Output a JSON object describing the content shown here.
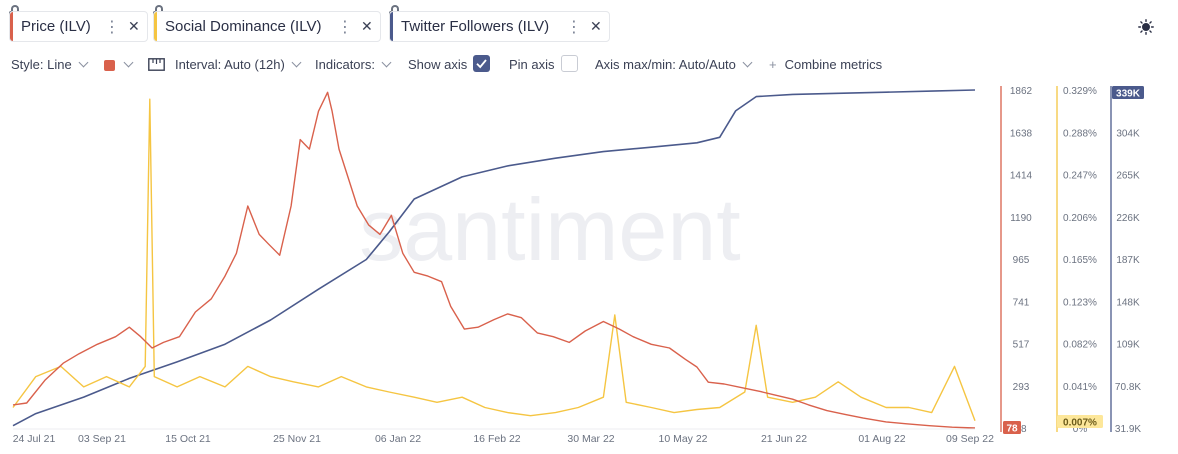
{
  "tabs": [
    {
      "label": "Price (ILV)",
      "color": "#d9614c"
    },
    {
      "label": "Social Dominance (ILV)",
      "color": "#f5c542"
    },
    {
      "label": "Twitter Followers (ILV)",
      "color": "#4b5a8c"
    }
  ],
  "toolbar": {
    "style": "Style: Line",
    "interval": "Interval: Auto (12h)",
    "indicators": "Indicators:",
    "show_axis": "Show axis",
    "show_axis_checked": true,
    "pin_axis": "Pin axis",
    "pin_axis_checked": false,
    "axis_maxmin": "Axis max/min: Auto/Auto",
    "combine": "Combine metrics"
  },
  "watermark": "santiment",
  "chart_data": {
    "type": "line",
    "x_ticks": [
      "24 Jul 21",
      "03 Sep 21",
      "15 Oct 21",
      "25 Nov 21",
      "06 Jan 22",
      "16 Feb 22",
      "30 Mar 22",
      "10 May 22",
      "21 Jun 22",
      "01 Aug 22",
      "09 Sep 22"
    ],
    "x_range": [
      "2021-07-14",
      "2022-09-09"
    ],
    "axes": [
      {
        "name": "Price (ILV)",
        "color": "#d9614c",
        "ticks": [
          "1862",
          "1638",
          "1414",
          "1190",
          "965",
          "741",
          "517",
          "293",
          "78"
        ],
        "range": [
          78,
          1862
        ],
        "current": "78"
      },
      {
        "name": "Social Dominance (ILV)",
        "color": "#f5c542",
        "ticks": [
          "0.329%",
          "0.288%",
          "0.247%",
          "0.206%",
          "0.165%",
          "0.123%",
          "0.082%",
          "0.041%",
          "0%"
        ],
        "range": [
          0,
          0.329
        ],
        "current": "0.007%"
      },
      {
        "name": "Twitter Followers (ILV)",
        "color": "#4b5a8c",
        "ticks": [
          "339K",
          "304K",
          "265K",
          "226K",
          "187K",
          "148K",
          "109K",
          "70.8K",
          "31.9K"
        ],
        "range": [
          31.9,
          339
        ],
        "current": "339K"
      }
    ],
    "series": [
      {
        "name": "Price (ILV)",
        "x": [
          "2021-07-14",
          "2021-07-20",
          "2021-07-28",
          "2021-08-05",
          "2021-08-12",
          "2021-08-20",
          "2021-08-28",
          "2021-09-03",
          "2021-09-08",
          "2021-09-13",
          "2021-09-18",
          "2021-09-25",
          "2021-10-02",
          "2021-10-09",
          "2021-10-15",
          "2021-10-20",
          "2021-10-25",
          "2021-10-30",
          "2021-11-03",
          "2021-11-08",
          "2021-11-13",
          "2021-11-17",
          "2021-11-21",
          "2021-11-25",
          "2021-11-29",
          "2021-12-01",
          "2021-12-04",
          "2021-12-08",
          "2021-12-12",
          "2021-12-17",
          "2021-12-22",
          "2021-12-27",
          "2022-01-01",
          "2022-01-06",
          "2022-01-12",
          "2022-01-18",
          "2022-01-22",
          "2022-01-28",
          "2022-02-03",
          "2022-02-10",
          "2022-02-16",
          "2022-02-22",
          "2022-03-01",
          "2022-03-08",
          "2022-03-15",
          "2022-03-22",
          "2022-03-30",
          "2022-04-06",
          "2022-04-12",
          "2022-04-20",
          "2022-04-28",
          "2022-05-05",
          "2022-05-10",
          "2022-05-15",
          "2022-05-22",
          "2022-05-30",
          "2022-06-07",
          "2022-06-14",
          "2022-06-21",
          "2022-06-28",
          "2022-07-06",
          "2022-07-14",
          "2022-07-22",
          "2022-08-01",
          "2022-08-10",
          "2022-08-20",
          "2022-08-30",
          "2022-09-09"
        ],
        "y": [
          200,
          210,
          330,
          420,
          470,
          520,
          560,
          610,
          560,
          500,
          530,
          560,
          690,
          760,
          880,
          1000,
          1250,
          1100,
          1050,
          990,
          1250,
          1600,
          1550,
          1750,
          1850,
          1750,
          1550,
          1400,
          1250,
          1150,
          1100,
          1200,
          1000,
          900,
          880,
          850,
          720,
          600,
          610,
          650,
          680,
          660,
          580,
          560,
          530,
          590,
          640,
          600,
          560,
          520,
          500,
          440,
          400,
          320,
          310,
          290,
          270,
          250,
          230,
          200,
          170,
          150,
          130,
          110,
          100,
          90,
          82,
          78
        ]
      },
      {
        "name": "Social Dominance (ILV)",
        "x": [
          "2021-07-14",
          "2021-07-24",
          "2021-08-04",
          "2021-08-14",
          "2021-08-24",
          "2021-09-03",
          "2021-09-10",
          "2021-09-12",
          "2021-09-14",
          "2021-09-24",
          "2021-10-04",
          "2021-10-15",
          "2021-10-25",
          "2021-11-04",
          "2021-11-14",
          "2021-11-25",
          "2021-12-05",
          "2021-12-16",
          "2021-12-26",
          "2022-01-06",
          "2022-01-16",
          "2022-01-27",
          "2022-02-06",
          "2022-02-16",
          "2022-02-26",
          "2022-03-09",
          "2022-03-19",
          "2022-03-30",
          "2022-04-04",
          "2022-04-09",
          "2022-04-20",
          "2022-04-30",
          "2022-05-10",
          "2022-05-20",
          "2022-05-31",
          "2022-06-05",
          "2022-06-10",
          "2022-06-21",
          "2022-07-01",
          "2022-07-11",
          "2022-07-21",
          "2022-08-01",
          "2022-08-11",
          "2022-08-21",
          "2022-08-31",
          "2022-09-09"
        ],
        "y": [
          0.02,
          0.05,
          0.06,
          0.04,
          0.05,
          0.04,
          0.06,
          0.32,
          0.05,
          0.04,
          0.05,
          0.04,
          0.06,
          0.05,
          0.045,
          0.04,
          0.05,
          0.04,
          0.035,
          0.03,
          0.025,
          0.03,
          0.02,
          0.015,
          0.012,
          0.015,
          0.02,
          0.03,
          0.11,
          0.025,
          0.02,
          0.015,
          0.018,
          0.02,
          0.035,
          0.1,
          0.03,
          0.025,
          0.03,
          0.045,
          0.03,
          0.02,
          0.02,
          0.015,
          0.06,
          0.007
        ]
      },
      {
        "name": "Twitter Followers (ILV)",
        "x": [
          "2021-07-14",
          "2021-07-24",
          "2021-08-14",
          "2021-09-03",
          "2021-09-24",
          "2021-10-15",
          "2021-11-04",
          "2021-11-25",
          "2021-12-16",
          "2021-12-26",
          "2022-01-06",
          "2022-01-27",
          "2022-02-16",
          "2022-03-09",
          "2022-03-30",
          "2022-04-20",
          "2022-05-10",
          "2022-05-20",
          "2022-05-27",
          "2022-06-05",
          "2022-06-21",
          "2022-07-11",
          "2022-08-01",
          "2022-08-21",
          "2022-09-09"
        ],
        "y": [
          34,
          45,
          60,
          77,
          92,
          108,
          130,
          158,
          185,
          210,
          240,
          260,
          270,
          277,
          283,
          287,
          291,
          296,
          320,
          333,
          335,
          336,
          337,
          338,
          339
        ]
      }
    ]
  }
}
